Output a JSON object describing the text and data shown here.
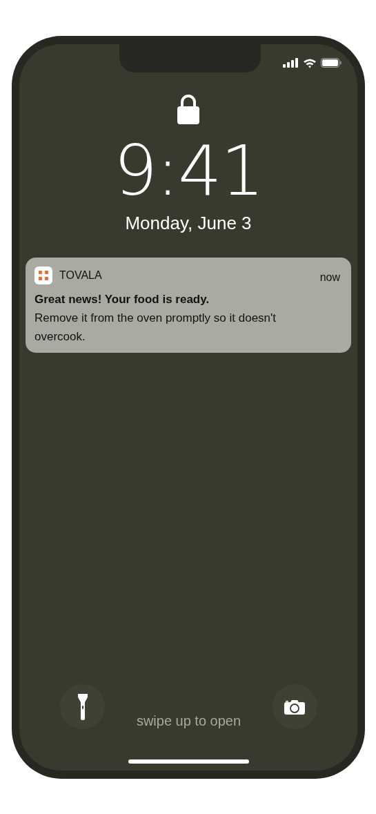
{
  "lock_screen": {
    "time": "9:41",
    "date": "Monday, June 3"
  },
  "notification": {
    "app": "TOVALA",
    "time": "now",
    "title": "Great news! Your food is ready.",
    "body": "Remove it from the oven promptly so it doesn't overcook."
  },
  "hint": "swipe up to open"
}
